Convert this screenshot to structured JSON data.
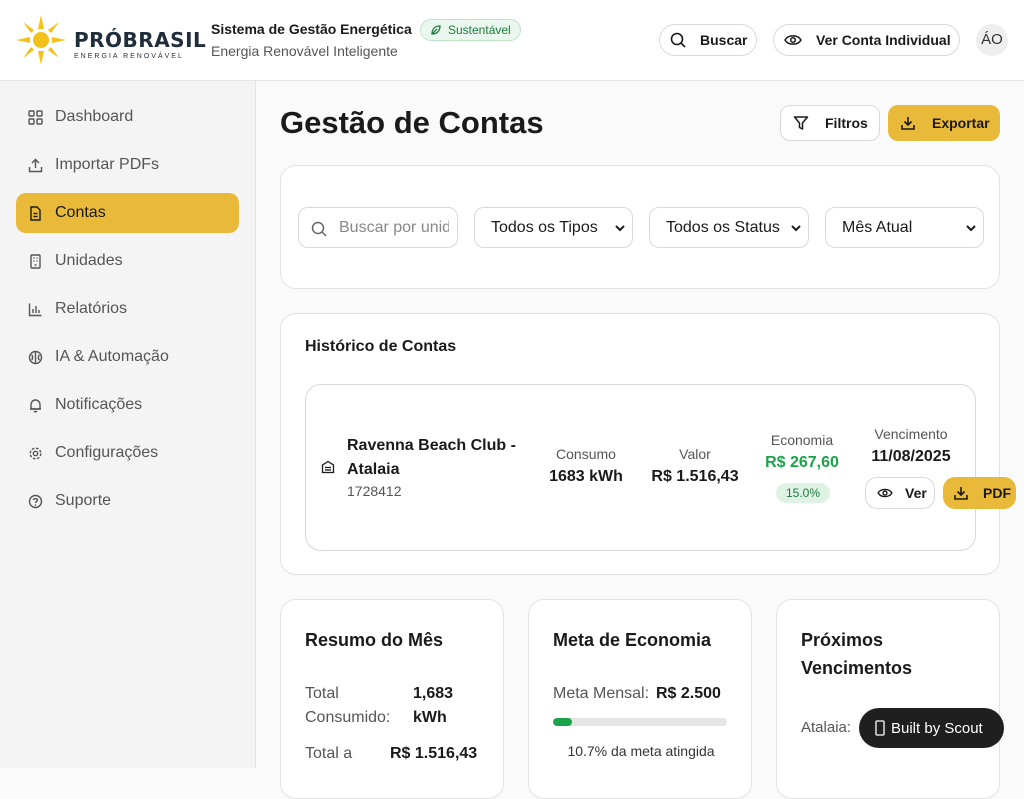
{
  "brand": {
    "logo_text": "PRÓBRASIL",
    "logo_sub": "ENERGIA RENOVÁVEL",
    "system_title": "Sistema de Gestão Energética",
    "badge": "Sustentável",
    "subtitle": "Energia Renovável Inteligente",
    "accent_color": "#e9b93a"
  },
  "topbar": {
    "search_label": "Buscar",
    "view_account_label": "Ver Conta Individual",
    "avatar_initials": "ÁO"
  },
  "sidebar": {
    "items": [
      {
        "label": "Dashboard",
        "icon": "dashboard-icon",
        "active": false
      },
      {
        "label": "Importar PDFs",
        "icon": "upload-icon",
        "active": false
      },
      {
        "label": "Contas",
        "icon": "document-icon",
        "active": true
      },
      {
        "label": "Unidades",
        "icon": "building-icon",
        "active": false
      },
      {
        "label": "Relatórios",
        "icon": "bar-chart-icon",
        "active": false
      },
      {
        "label": "IA & Automação",
        "icon": "brain-icon",
        "active": false
      },
      {
        "label": "Notificações",
        "icon": "bell-icon",
        "active": false
      },
      {
        "label": "Configurações",
        "icon": "gear-icon",
        "active": false
      },
      {
        "label": "Suporte",
        "icon": "help-icon",
        "active": false
      }
    ]
  },
  "main": {
    "title": "Gestão de Contas",
    "filters_label": "Filtros",
    "export_label": "Exportar"
  },
  "filters": {
    "search_placeholder": "Buscar por unidade...",
    "type_value": "Todos os Tipos",
    "status_value": "Todos os Status",
    "period_value": "Mês Atual"
  },
  "history": {
    "title": "Histórico de Contas",
    "bills": [
      {
        "name": "Ravenna Beach Club - Atalaia",
        "code": "1728412",
        "consumo_label": "Consumo",
        "consumo_value": "1683 kWh",
        "valor_label": "Valor",
        "valor_value": "R$ 1.516,43",
        "economia_label": "Economia",
        "economia_value": "R$ 267,60",
        "economia_pct": "15.0%",
        "vencimento_label": "Vencimento",
        "vencimento_value": "11/08/2025",
        "view_label": "Ver",
        "pdf_label": "PDF"
      }
    ]
  },
  "summary": {
    "title": "Resumo do Mês",
    "total_consumed_label": "Total Consumido:",
    "total_consumed_value": "1,683 kWh",
    "total_pay_label": "Total a",
    "total_pay_value": "R$ 1.516,43"
  },
  "goal": {
    "title": "Meta de Economia",
    "monthly_label": "Meta Mensal:",
    "monthly_value": "R$ 2.500",
    "progress_fraction": 0.107,
    "progress_text": "10.7% da meta atingida"
  },
  "upcoming": {
    "title": "Próximos Vencimentos",
    "first_label": "Atalaia:"
  },
  "footer": {
    "scout_label": "Built by Scout"
  }
}
